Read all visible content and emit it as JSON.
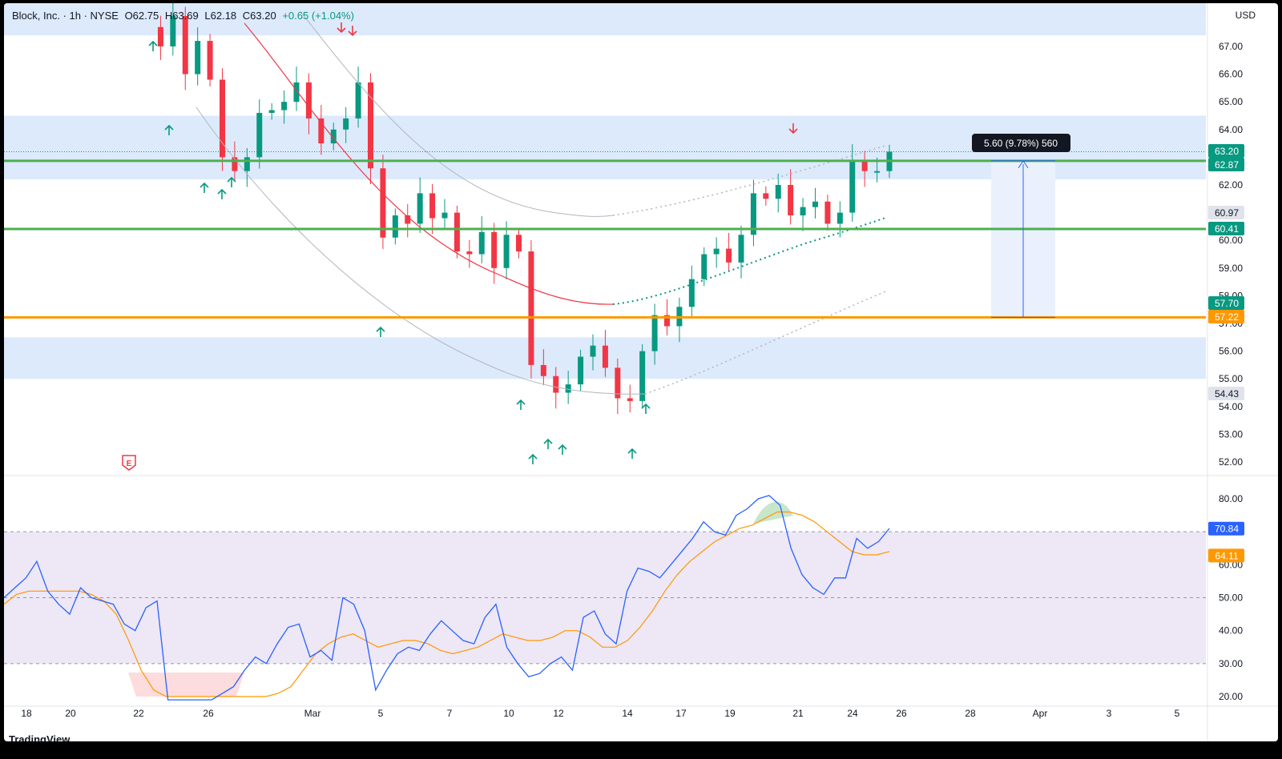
{
  "header": {
    "symbol": "Block, Inc. · 1h · NYSE",
    "open": "O62.75",
    "high": "H63.69",
    "low": "L62.18",
    "close": "C63.20",
    "change": "+0.65 (+1.04%)"
  },
  "currency": "USD",
  "watermark": "TradingView",
  "colors": {
    "up": "#089981",
    "down": "#f23645",
    "zone": "#d6e6fb",
    "support_green": "#4caf50",
    "support_orange": "#ff9800",
    "rsi": "#2962ff",
    "rsi_ma": "#ff9800",
    "rsi_band": "#ede7f6"
  },
  "chart_data": [
    {
      "type": "candlestick",
      "title": "Block, Inc. · 1h · NYSE",
      "ylim": [
        51.5,
        68.6
      ],
      "price_ticks": [
        "67.00",
        "66.00",
        "65.00",
        "64.00",
        "63.00",
        "62.00",
        "61.00",
        "60.00",
        "59.00",
        "58.00",
        "57.00",
        "56.00",
        "55.00",
        "54.00",
        "53.00",
        "52.00"
      ],
      "x_ticks": [
        "18",
        "20",
        "22",
        "26",
        "Mar",
        "5",
        "7",
        "10",
        "12",
        "14",
        "17",
        "19",
        "21",
        "24",
        "26",
        "28",
        "Apr",
        "3",
        "5"
      ],
      "price_labels": [
        {
          "value": "63.20",
          "style": "green"
        },
        {
          "value": "62.87",
          "style": "green"
        },
        {
          "value": "60.97",
          "style": "grey"
        },
        {
          "value": "60.41",
          "style": "green"
        },
        {
          "value": "57.70",
          "style": "green"
        },
        {
          "value": "57.22",
          "style": "orange"
        },
        {
          "value": "54.43",
          "style": "grey"
        }
      ],
      "horizontal_lines": [
        {
          "price": 62.87,
          "color": "green"
        },
        {
          "price": 60.41,
          "color": "green"
        },
        {
          "price": 57.22,
          "color": "orange"
        }
      ],
      "zones": [
        [
          67.4,
          68.6
        ],
        [
          62.2,
          64.5
        ],
        [
          55.0,
          56.5
        ]
      ],
      "measure": {
        "from": 57.22,
        "to": 62.87,
        "label": "5.60 (9.78%) 560"
      },
      "event_marker": "E",
      "close_path": [
        67.7,
        67.0,
        68.1,
        66.0,
        67.2,
        65.8,
        63.0,
        62.5,
        63.0,
        64.6,
        64.7,
        65.0,
        65.7,
        64.4,
        63.5,
        64.0,
        64.4,
        65.7,
        62.6,
        60.1,
        60.9,
        60.6,
        61.7,
        60.8,
        61.0,
        59.6,
        59.5,
        60.3,
        59.0,
        60.2,
        59.6,
        55.5,
        55.1,
        54.5,
        54.8,
        55.8,
        56.2,
        55.4,
        54.3,
        54.2,
        56.0,
        57.3,
        56.9,
        57.6,
        58.6,
        59.5,
        59.7,
        59.2,
        60.2,
        61.7,
        61.5,
        62.0,
        60.9,
        61.2,
        61.4,
        60.6,
        61.0,
        62.9,
        62.5,
        62.5,
        63.2
      ]
    },
    {
      "type": "line",
      "title": "RSI",
      "ylim": [
        18,
        82
      ],
      "y_ticks": [
        "80.00",
        "60.00",
        "50.00",
        "40.00",
        "30.00",
        "20.00"
      ],
      "band": [
        30,
        70
      ],
      "current": {
        "rsi": "70.84",
        "ma": "64.11"
      },
      "series": [
        {
          "values": [
            50,
            53,
            56,
            61,
            52,
            48,
            45,
            53,
            50,
            49,
            48,
            42,
            40,
            47,
            49,
            19,
            19,
            19,
            19,
            19,
            21,
            23,
            28,
            32,
            30,
            36,
            41,
            42,
            32,
            34,
            31,
            50,
            48,
            40,
            22,
            28,
            33,
            35,
            34,
            39,
            43,
            40,
            37,
            36,
            44,
            48,
            35,
            30,
            26,
            27,
            30,
            32,
            28,
            44,
            46,
            39,
            36,
            52,
            59,
            58,
            56,
            60,
            64,
            68,
            73,
            70,
            69,
            75,
            77,
            80,
            81,
            78,
            65,
            57,
            53,
            51,
            56,
            56,
            68,
            65,
            67,
            71
          ]
        },
        {
          "values": [
            48,
            51,
            52,
            52,
            52,
            52,
            52,
            51,
            49,
            45,
            37,
            28,
            22,
            20,
            20,
            20,
            20,
            20,
            20,
            20,
            20,
            20,
            21,
            23,
            28,
            33,
            36,
            38,
            39,
            37,
            35,
            36,
            37,
            37,
            36,
            34,
            33,
            34,
            35,
            37,
            39,
            38,
            37,
            37,
            38,
            40,
            40,
            38,
            35,
            35,
            37,
            41,
            46,
            52,
            57,
            61,
            64,
            67,
            69,
            71,
            72,
            74,
            76,
            76,
            75,
            73,
            70,
            67,
            64,
            63,
            63,
            64
          ]
        }
      ]
    }
  ]
}
